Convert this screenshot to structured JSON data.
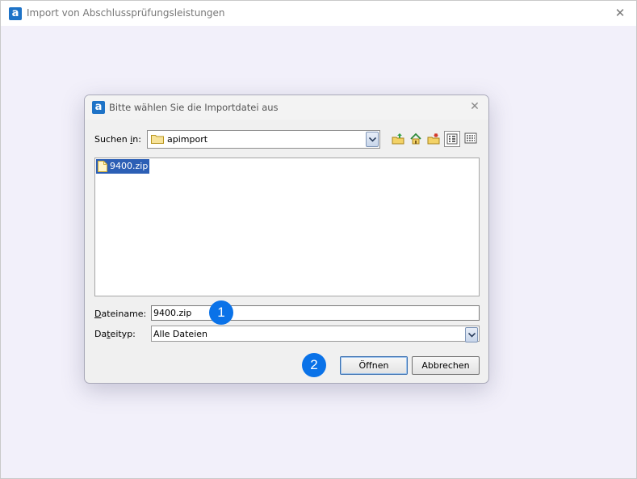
{
  "window": {
    "title": "Import von Abschlussprüfungsleistungen",
    "close_glyph": "✕"
  },
  "dialog": {
    "title": "Bitte wählen Sie die Importdatei aus",
    "close_glyph": "✕",
    "look_in": {
      "label_pre": "Suchen ",
      "label_accel": "i",
      "label_post": "n:",
      "value": "apimport"
    },
    "toolbar": {
      "icons": [
        "up-folder-icon",
        "home-icon",
        "new-folder-icon",
        "list-view-icon",
        "details-view-icon"
      ]
    },
    "files": [
      {
        "name": "9400.zip",
        "selected": true
      }
    ],
    "filename": {
      "label_accel": "D",
      "label_post": "ateiname:",
      "value": "9400.zip"
    },
    "filetype": {
      "label_pre": "Da",
      "label_accel": "t",
      "label_post": "eityp:",
      "value": "Alle Dateien"
    },
    "buttons": {
      "open": "Öffnen",
      "cancel": "Abbrechen"
    }
  },
  "annotations": {
    "badge1": "1",
    "badge2": "2"
  },
  "colors": {
    "accent": "#0a72e8",
    "selection": "#2c5fb5",
    "app_icon": "#1e73c7",
    "window_bg": "#f2f0fa"
  }
}
